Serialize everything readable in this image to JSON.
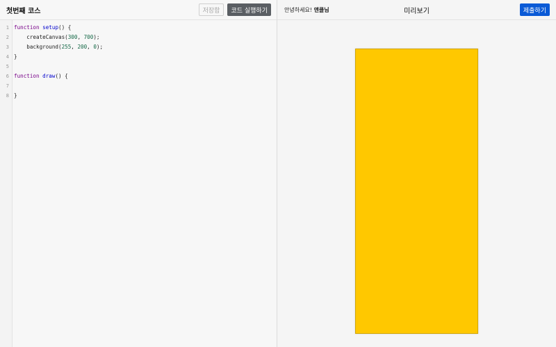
{
  "editor": {
    "course_title": "첫번째 코스",
    "save_label": "저장함",
    "run_label": "코드 실행하기",
    "line_numbers": [
      "1",
      "2",
      "3",
      "4",
      "5",
      "6",
      "7",
      "8"
    ],
    "code": {
      "l1_kw": "function",
      "l1_fn": "setup",
      "l1_rest": "() {",
      "l2_call": "    createCanvas(",
      "l2_n1": "300",
      "l2_sep": ", ",
      "l2_n2": "700",
      "l2_end": ");",
      "l3_call": "    background(",
      "l3_n1": "255",
      "l3_sep1": ", ",
      "l3_n2": "200",
      "l3_sep2": ", ",
      "l3_n3": "0",
      "l3_end": ");",
      "l4": "}",
      "l6_kw": "function",
      "l6_fn": "draw",
      "l6_rest": "() {",
      "l8": "}"
    }
  },
  "preview": {
    "greeting_prefix": "안녕하세요! ",
    "user_name": "앤클님",
    "title": "미리보기",
    "submit_label": "제출하기",
    "canvas_color": "#ffc800"
  },
  "colors": {
    "run_button": "#5a5e63",
    "submit_button": "#0a5ad6",
    "keyword": "#770088",
    "function_name": "#0000cc",
    "number": "#116644"
  }
}
